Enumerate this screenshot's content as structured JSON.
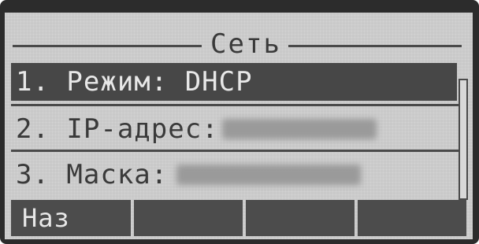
{
  "screen": {
    "title": "Сеть",
    "menu": [
      {
        "label": "1. Режим: DHCP",
        "selected": true
      },
      {
        "label": "2. IP-адрес:",
        "value_obscured": true
      },
      {
        "label": "3. Маска:",
        "value_obscured": true
      }
    ],
    "softkeys": [
      "Наз",
      "",
      "",
      ""
    ]
  },
  "colors": {
    "lcd_background": "#c9c9c9",
    "text": "#3a3a3a",
    "highlight": "#474747",
    "bezel": "#2c2c2c"
  }
}
